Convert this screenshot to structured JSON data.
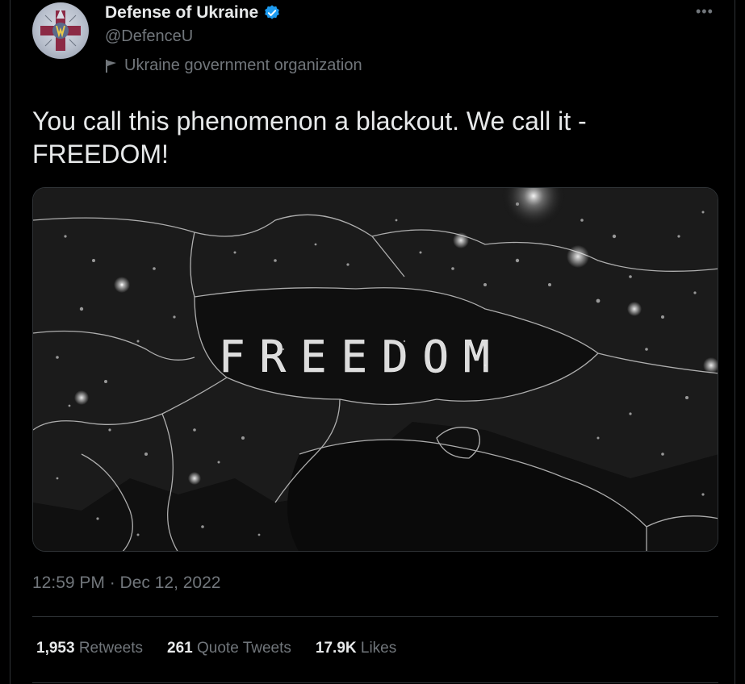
{
  "author": {
    "name": "Defense of Ukraine",
    "handle": "@DefenceU",
    "label": "Ukraine government organization",
    "verified": true
  },
  "tweet": {
    "text_line1": "You call this phenomenon a blackout. We call it -",
    "text_line2": "FREEDOM!",
    "image_text": "FREEDOM",
    "timestamp": "12:59 PM · Dec 12, 2022"
  },
  "stats": {
    "retweets_count": "1,953",
    "retweets_label": "Retweets",
    "quotes_count": "261",
    "quotes_label": "Quote Tweets",
    "likes_count": "17.9K",
    "likes_label": "Likes"
  },
  "colors": {
    "background": "#000000",
    "text": "#e7e9ea",
    "muted": "#71767b",
    "verified": "#1d9bf0",
    "divider": "#2f3336"
  }
}
